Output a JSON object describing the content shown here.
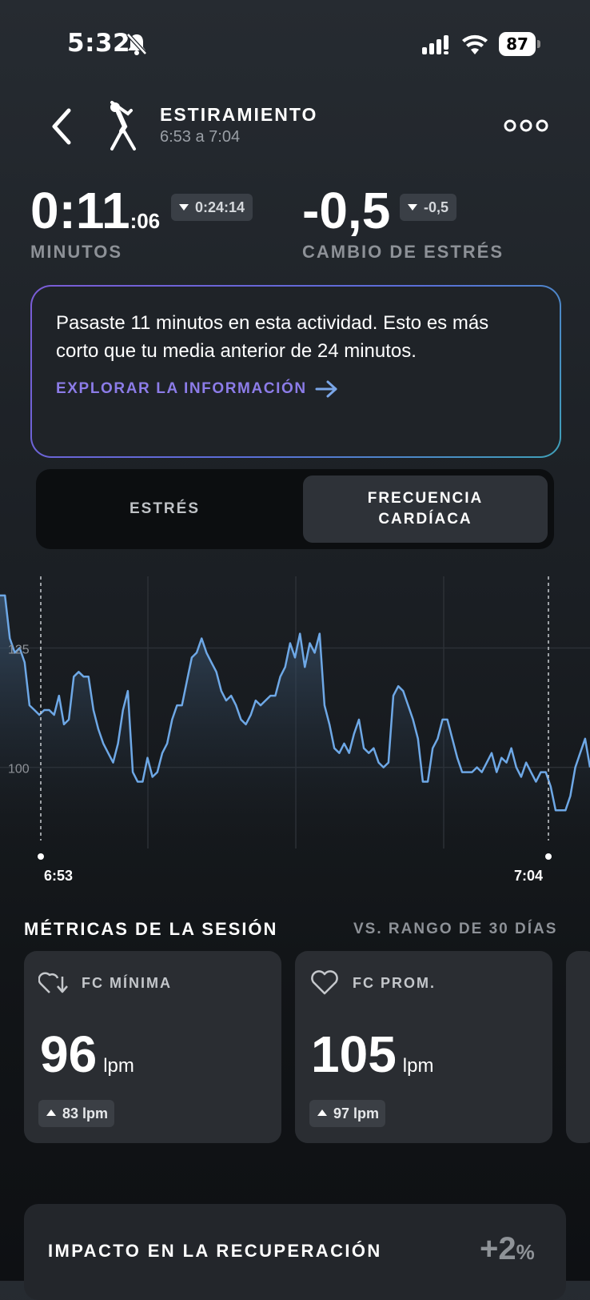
{
  "status_bar": {
    "time": "5:32",
    "battery": "87"
  },
  "header": {
    "title": "ESTIRAMIENTO",
    "time_range": "6:53 a 7:04"
  },
  "metrics": {
    "minutes": {
      "main": "0:11",
      "seconds": ":06",
      "chip": "0:24:14",
      "label": "MINUTOS"
    },
    "stress": {
      "main": "-0,5",
      "chip": "-0,5",
      "label": "CAMBIO DE ESTRÉS"
    }
  },
  "insight": {
    "text": "Pasaste 11 minutos en esta actividad. Esto es más corto que tu media anterior de 24 minutos.",
    "link": "EXPLORAR LA INFORMACIÓN"
  },
  "toggle": {
    "option1": "ESTRÉS",
    "option2": "FRECUENCIA CARDÍACA"
  },
  "chart_data": {
    "type": "line",
    "ylabel_ticks": [
      "125",
      "100"
    ],
    "x_start_label": "6:53",
    "x_end_label": "7:04",
    "y_ticks": [
      100,
      125
    ],
    "ylim": [
      83,
      140
    ],
    "series": [
      {
        "values": [
          136,
          136,
          127,
          124,
          125,
          122,
          113,
          112,
          111,
          112,
          112,
          111,
          115,
          109,
          110,
          119,
          120,
          119,
          119,
          112,
          108,
          105,
          103,
          101,
          105,
          112,
          116,
          99,
          97,
          97,
          102,
          98,
          99,
          103,
          105,
          110,
          113,
          113,
          118,
          123,
          124,
          127,
          124,
          122,
          120,
          116,
          114,
          115,
          113,
          110,
          109,
          111,
          114,
          113,
          114,
          115,
          115,
          119,
          121,
          126,
          123,
          128,
          121,
          126,
          124,
          128,
          113,
          109,
          104,
          103,
          105,
          103,
          107,
          110,
          104,
          103,
          104,
          101,
          100,
          101,
          115,
          117,
          116,
          113,
          110,
          106,
          97,
          97,
          104,
          106,
          110,
          110,
          106,
          102,
          99,
          99,
          99,
          100,
          99,
          101,
          103,
          99,
          102,
          101,
          104,
          100,
          98,
          101,
          99,
          97,
          99,
          99,
          96,
          91,
          91,
          91,
          94,
          100,
          103,
          106,
          100
        ]
      }
    ]
  },
  "session_metrics": {
    "title": "MÉTRICAS DE LA SESIÓN",
    "compare": "VS. RANGO DE 30 DÍAS",
    "cards": [
      {
        "label": "FC MÍNIMA",
        "value": "96",
        "unit": "lpm",
        "chip": "83 lpm",
        "icon": "heart-down-icon"
      },
      {
        "label": "FC PROM.",
        "value": "105",
        "unit": "lpm",
        "chip": "97 lpm",
        "icon": "heart-icon"
      }
    ]
  },
  "impact": {
    "title": "IMPACTO EN LA RECUPERACIÓN",
    "value": "+2",
    "pct": "%"
  }
}
